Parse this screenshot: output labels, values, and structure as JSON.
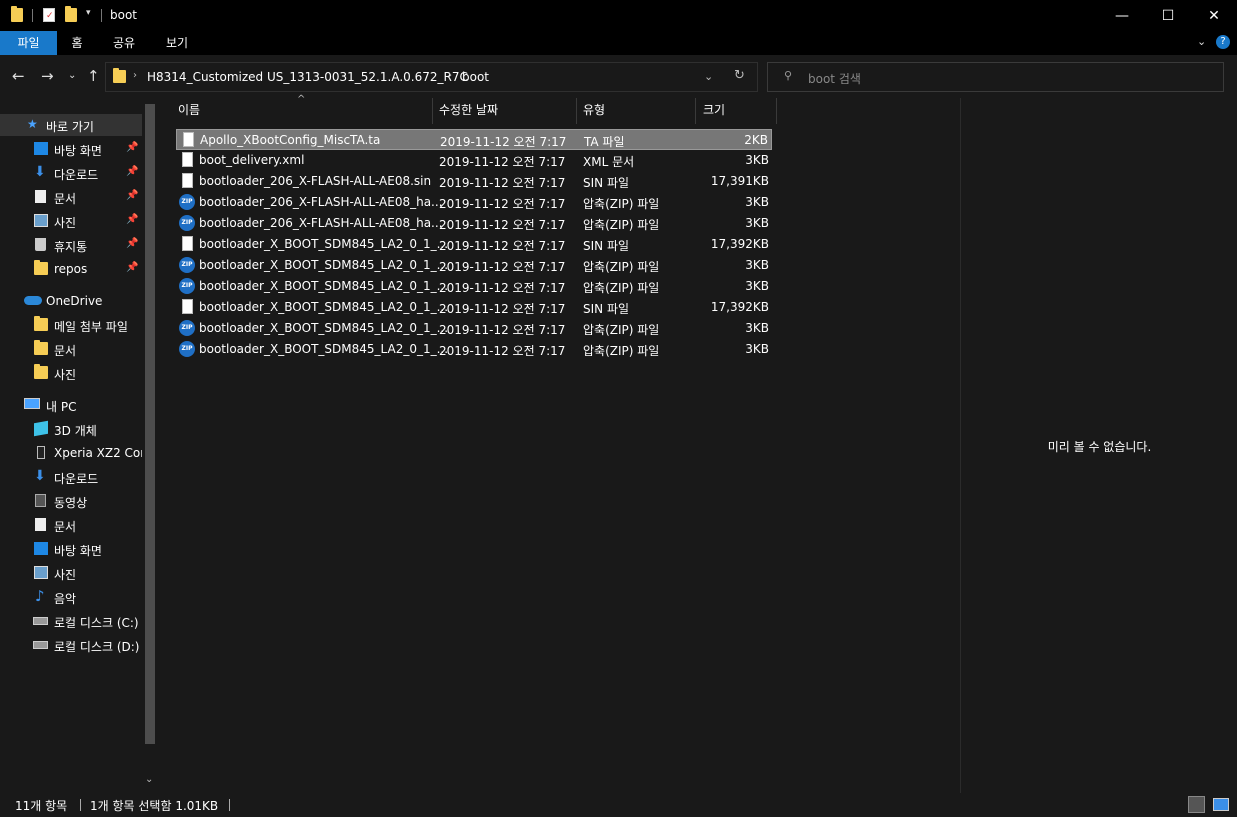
{
  "window": {
    "title": "boot",
    "controls": {
      "minimize": "—",
      "maximize": "☐",
      "close": "✕"
    }
  },
  "quick_access_toolbar": [
    "folder-icon",
    "properties-icon",
    "new-folder-icon",
    "customize-icon"
  ],
  "ribbon": {
    "tabs": [
      {
        "label": "파일",
        "active": true
      },
      {
        "label": "홈"
      },
      {
        "label": "공유"
      },
      {
        "label": "보기"
      }
    ]
  },
  "address_bar": {
    "crumbs": [
      "H8314_Customized US_1313-0031_52.1.A.0.672_R7C",
      "boot"
    ]
  },
  "search": {
    "placeholder": "boot 검색"
  },
  "nav": {
    "quick_access": {
      "label": "바로 가기",
      "items": [
        {
          "label": "바탕 화면",
          "icon": "desktop-icon",
          "pinned": true
        },
        {
          "label": "다운로드",
          "icon": "download-icon",
          "pinned": true
        },
        {
          "label": "문서",
          "icon": "document-icon",
          "pinned": true
        },
        {
          "label": "사진",
          "icon": "pictures-icon",
          "pinned": true
        },
        {
          "label": "휴지통",
          "icon": "recycle-bin-icon",
          "pinned": true
        },
        {
          "label": "repos",
          "icon": "folder-icon",
          "pinned": true
        }
      ]
    },
    "onedrive": {
      "label": "OneDrive",
      "items": [
        {
          "label": "메일 첨부 파일",
          "icon": "folder-icon"
        },
        {
          "label": "문서",
          "icon": "folder-icon"
        },
        {
          "label": "사진",
          "icon": "folder-icon"
        }
      ]
    },
    "this_pc": {
      "label": "내 PC",
      "items": [
        {
          "label": "3D 개체",
          "icon": "3d-objects-icon"
        },
        {
          "label": "Xperia XZ2 Com",
          "icon": "phone-icon"
        },
        {
          "label": "다운로드",
          "icon": "download-icon"
        },
        {
          "label": "동영상",
          "icon": "video-icon"
        },
        {
          "label": "문서",
          "icon": "document-icon"
        },
        {
          "label": "바탕 화면",
          "icon": "desktop-icon"
        },
        {
          "label": "사진",
          "icon": "pictures-icon"
        },
        {
          "label": "음악",
          "icon": "music-icon"
        },
        {
          "label": "로컬 디스크 (C:)",
          "icon": "drive-icon"
        },
        {
          "label": "로컬 디스크 (D:)",
          "icon": "drive-icon"
        }
      ]
    }
  },
  "file_list": {
    "columns": [
      "이름",
      "수정한 날짜",
      "유형",
      "크기"
    ],
    "files": [
      {
        "name": "Apollo_XBootConfig_MiscTA.ta",
        "date": "2019-11-12 오전 7:17",
        "type": "TA 파일",
        "size": "2KB",
        "icon": "document-icon",
        "selected": true
      },
      {
        "name": "boot_delivery.xml",
        "date": "2019-11-12 오전 7:17",
        "type": "XML 문서",
        "size": "3KB",
        "icon": "document-icon"
      },
      {
        "name": "bootloader_206_X-FLASH-ALL-AE08.sin",
        "date": "2019-11-12 오전 7:17",
        "type": "SIN 파일",
        "size": "17,391KB",
        "icon": "document-icon"
      },
      {
        "name": "bootloader_206_X-FLASH-ALL-AE08_ha...",
        "date": "2019-11-12 오전 7:17",
        "type": "압축(ZIP) 파일",
        "size": "3KB",
        "icon": "zip-icon"
      },
      {
        "name": "bootloader_206_X-FLASH-ALL-AE08_ha...",
        "date": "2019-11-12 오전 7:17",
        "type": "압축(ZIP) 파일",
        "size": "3KB",
        "icon": "zip-icon"
      },
      {
        "name": "bootloader_X_BOOT_SDM845_LA2_0_1_...",
        "date": "2019-11-12 오전 7:17",
        "type": "SIN 파일",
        "size": "17,392KB",
        "icon": "document-icon"
      },
      {
        "name": "bootloader_X_BOOT_SDM845_LA2_0_1_...",
        "date": "2019-11-12 오전 7:17",
        "type": "압축(ZIP) 파일",
        "size": "3KB",
        "icon": "zip-icon"
      },
      {
        "name": "bootloader_X_BOOT_SDM845_LA2_0_1_...",
        "date": "2019-11-12 오전 7:17",
        "type": "압축(ZIP) 파일",
        "size": "3KB",
        "icon": "zip-icon"
      },
      {
        "name": "bootloader_X_BOOT_SDM845_LA2_0_1_...",
        "date": "2019-11-12 오전 7:17",
        "type": "SIN 파일",
        "size": "17,392KB",
        "icon": "document-icon"
      },
      {
        "name": "bootloader_X_BOOT_SDM845_LA2_0_1_...",
        "date": "2019-11-12 오전 7:17",
        "type": "압축(ZIP) 파일",
        "size": "3KB",
        "icon": "zip-icon"
      },
      {
        "name": "bootloader_X_BOOT_SDM845_LA2_0_1_...",
        "date": "2019-11-12 오전 7:17",
        "type": "압축(ZIP) 파일",
        "size": "3KB",
        "icon": "zip-icon"
      }
    ]
  },
  "preview": {
    "message": "미리 볼 수 없습니다."
  },
  "status": {
    "item_count": "11개 항목",
    "selection": "1개 항목 선택함 1.01KB"
  },
  "colors": {
    "accent": "#1979ca",
    "background": "#191919",
    "titlebar": "#000000",
    "selected_row": "#777777",
    "folder": "#f6cd55"
  }
}
